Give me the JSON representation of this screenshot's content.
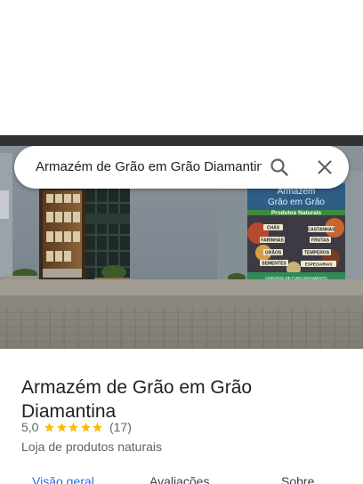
{
  "search": {
    "query": "Armazém de Grão em Grão Diamantina",
    "search_icon": "search-icon",
    "close_icon": "close-icon"
  },
  "photo": {
    "sign": {
      "line1": "Armazém",
      "line2": "Grão em Grão",
      "subtitle": "Produtos Naturais",
      "tags": [
        "CHÁS",
        "CASTANHAS",
        "FARINHAS",
        "FRUTAS",
        "GRÃOS",
        "TEMPEROS",
        "SEMENTES",
        "ESPECIARIAS"
      ],
      "hours_label": "HORÁRIO DE FUNCIONAMENTO"
    }
  },
  "place": {
    "name": "Armazém de Grão em Grão Diamantina",
    "rating": "5,0",
    "stars": 5,
    "reviews": "(17)",
    "category": "Loja de produtos naturais"
  },
  "tabs": [
    {
      "label": "Visão geral",
      "active": true
    },
    {
      "label": "Avaliações",
      "active": false
    },
    {
      "label": "Sobre",
      "active": false
    }
  ],
  "colors": {
    "accent": "#1a73e8",
    "star": "#fbbc04",
    "text_primary": "#202124",
    "text_secondary": "#5f6368"
  }
}
